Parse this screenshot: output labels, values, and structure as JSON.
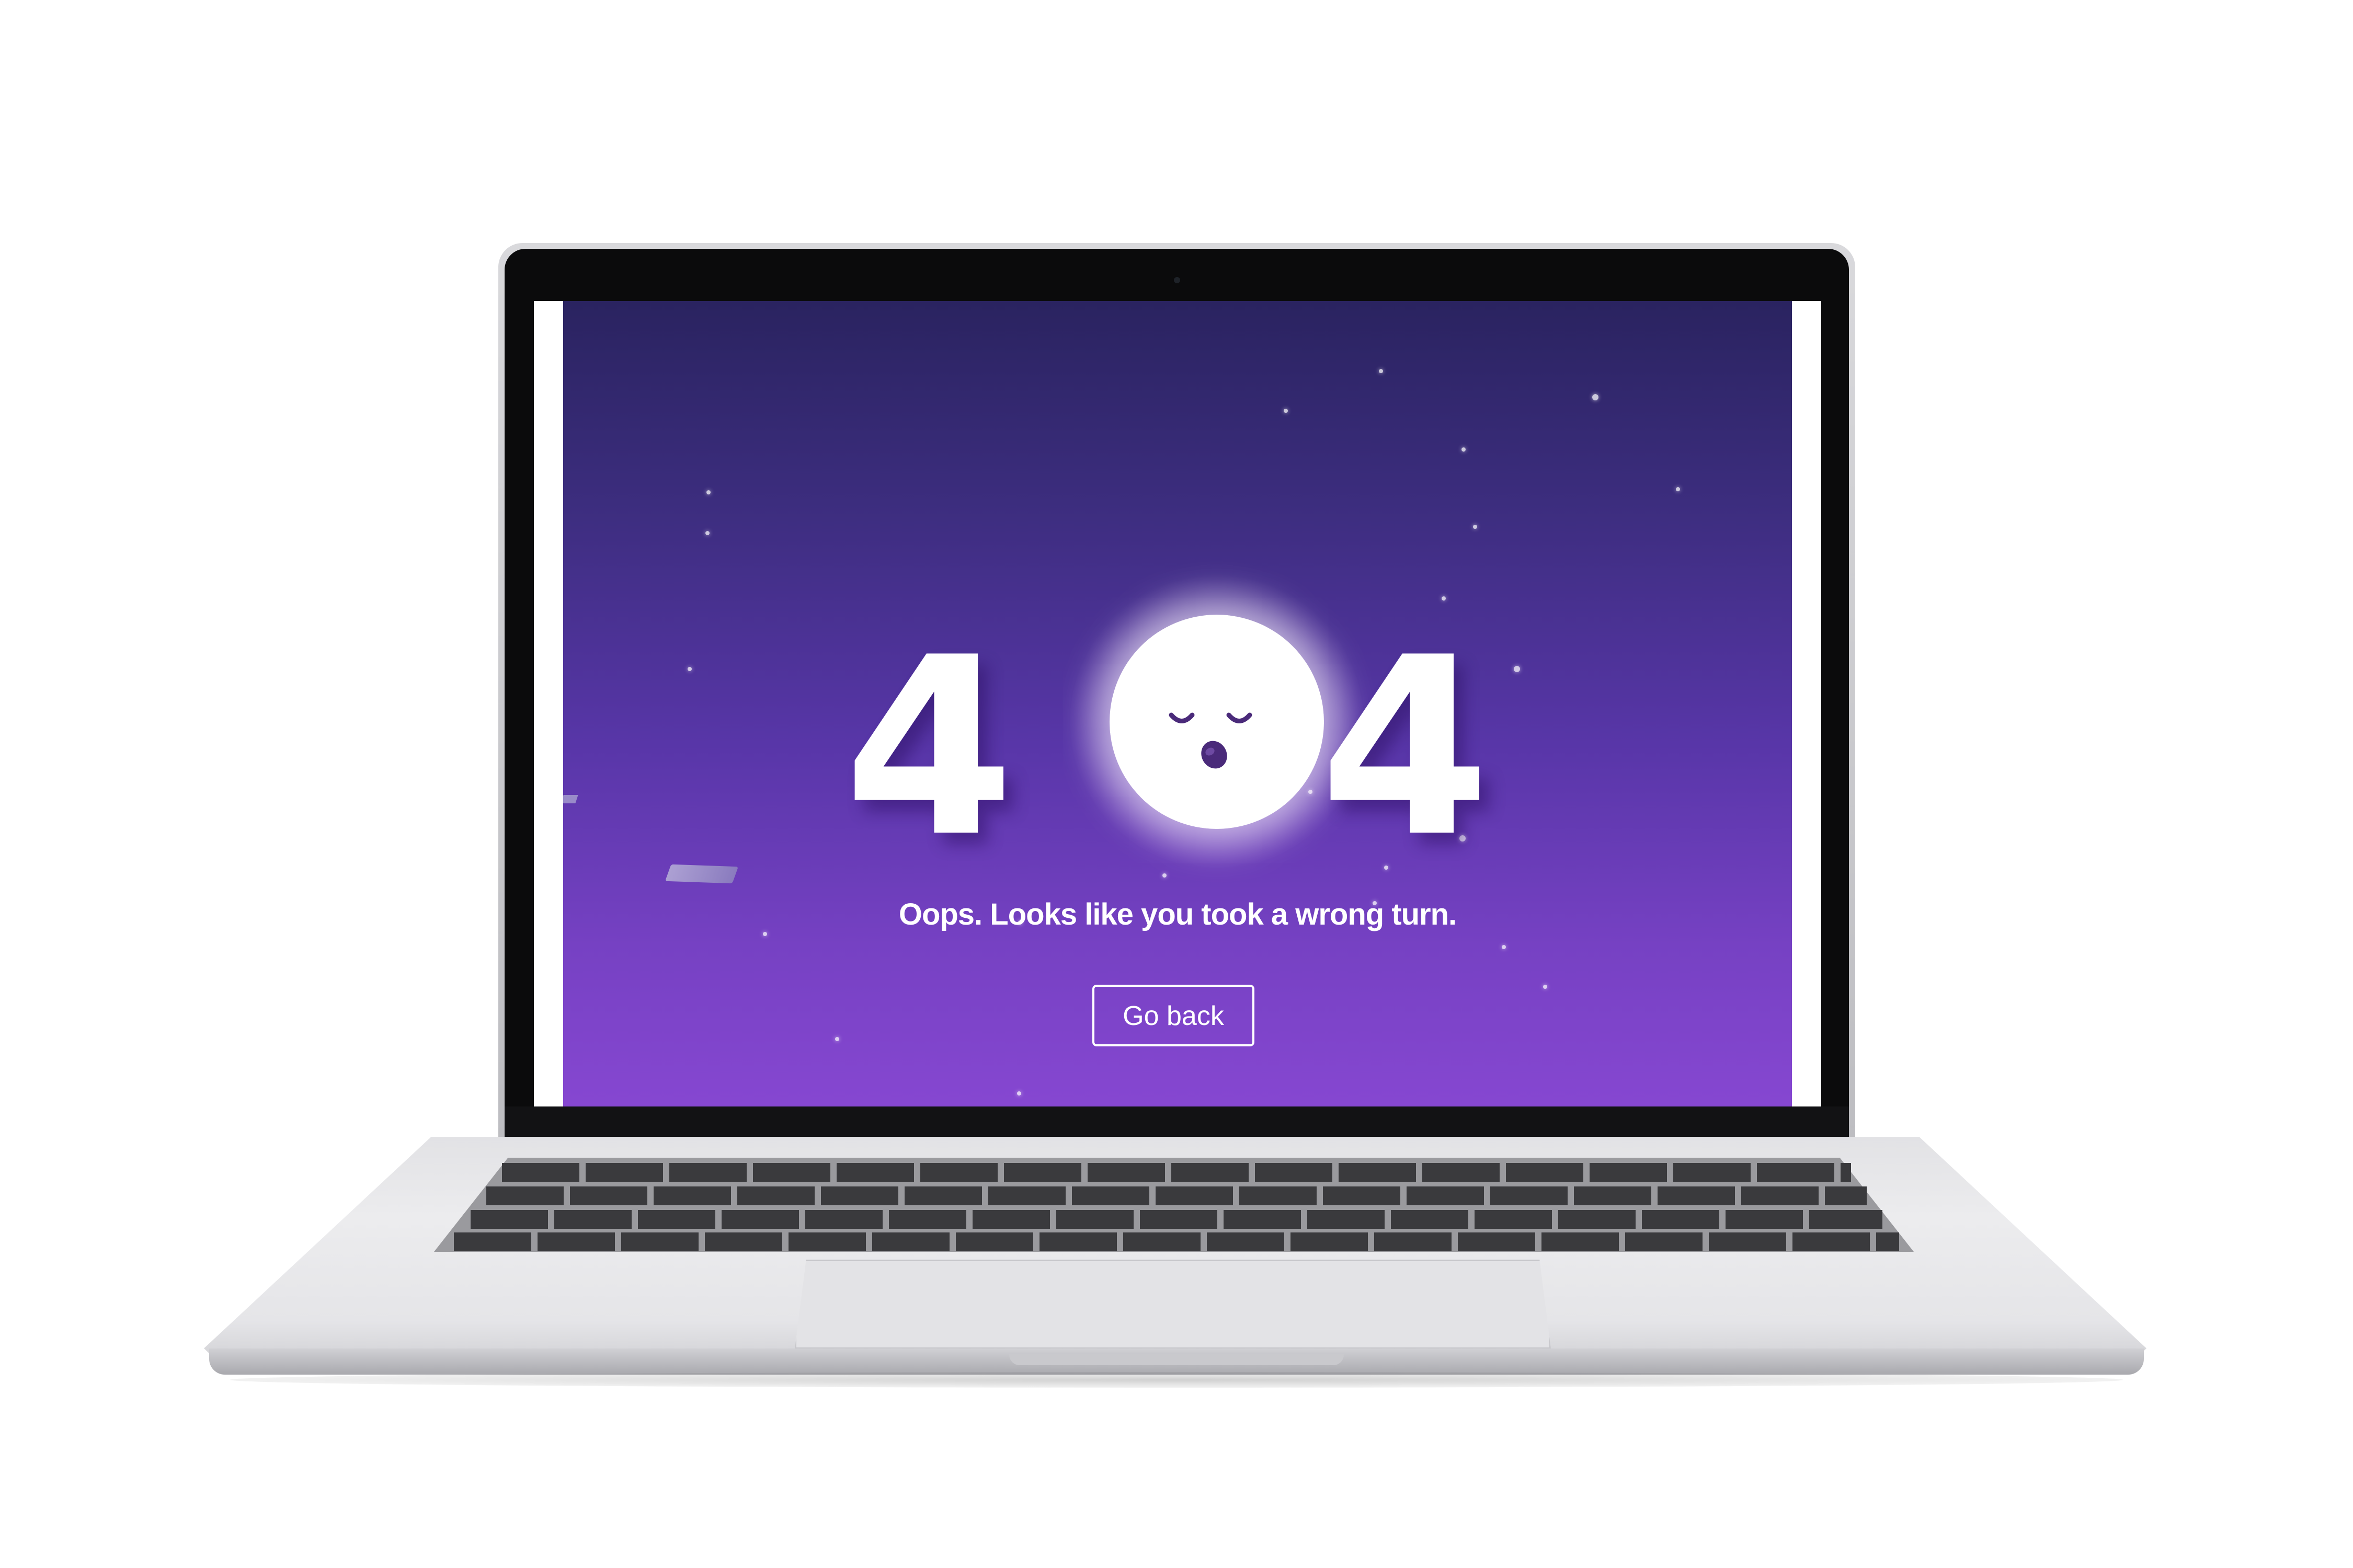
{
  "error_page": {
    "digit_left": "4",
    "digit_right": "4",
    "message": "Oops. Looks like you took a wrong turn.",
    "go_back_label": "Go back"
  },
  "icons": {
    "moon": "sleeping-moon-icon",
    "paper": "paper-airplane-icon"
  },
  "colors": {
    "background_top": "#2a2360",
    "background_bottom": "#8647d1",
    "text": "#ffffff"
  }
}
